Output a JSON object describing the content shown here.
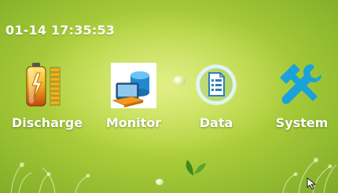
{
  "status": {
    "datetime": "01-14 17:35:53"
  },
  "apps": [
    {
      "id": "discharge",
      "label": "Discharge",
      "icon": "battery-icon"
    },
    {
      "id": "monitor",
      "label": "Monitor",
      "icon": "monitor-icon"
    },
    {
      "id": "data",
      "label": "Data",
      "icon": "document-icon"
    },
    {
      "id": "system",
      "label": "System",
      "icon": "tools-icon"
    }
  ],
  "colors": {
    "background": "#b3d23e",
    "label_text": "#ffffff",
    "data_ring": "#d8f2ff",
    "system_icon": "#1aa3d9"
  }
}
